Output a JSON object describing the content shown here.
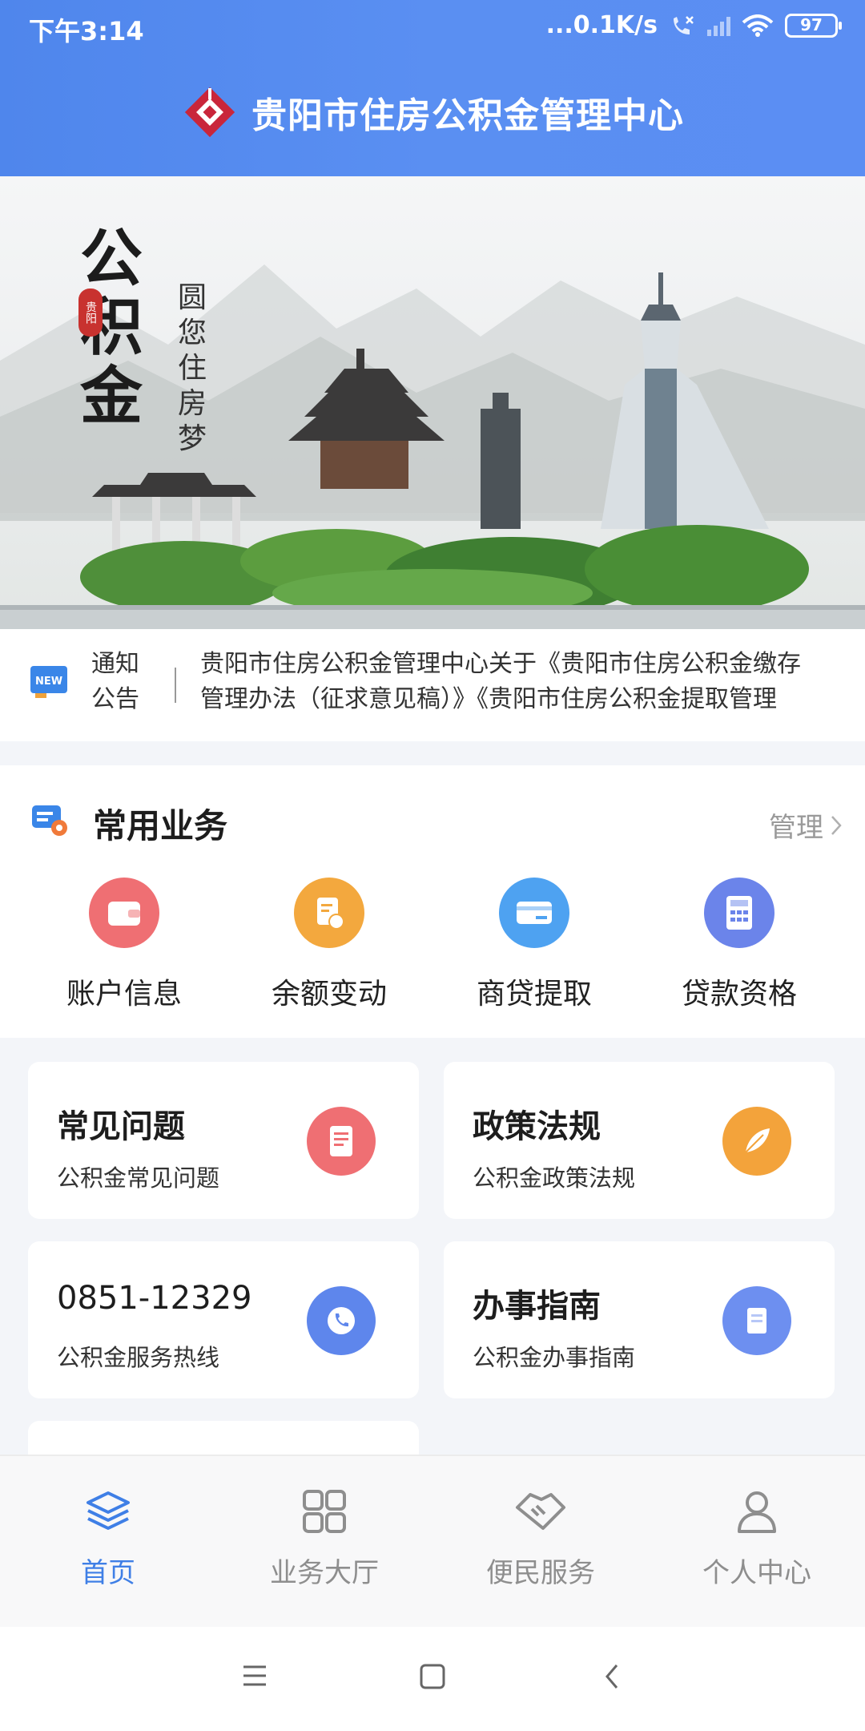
{
  "status_bar": {
    "time": "下午3:14",
    "network_speed": "...0.1K/s",
    "battery": "97"
  },
  "header": {
    "title": "贵阳市住房公积金管理中心",
    "brand_color": "#4f86ec"
  },
  "banner": {
    "slogan_big": "公积金",
    "slogan_small": "圆您住房梦",
    "seal": "贵阳"
  },
  "notice": {
    "label": "通知公告",
    "text_line1": "贵阳市住房公积金管理中心关于《贵阳市住房公积金缴存",
    "text_line2": "管理办法（征求意见稿）》《贵阳市住房公积金提取管理"
  },
  "common_services": {
    "title": "常用业务",
    "manage_label": "管理",
    "items": [
      {
        "label": "账户信息",
        "icon": "wallet-icon",
        "color": "#ef6f73"
      },
      {
        "label": "余额变动",
        "icon": "document-coin-icon",
        "color": "#f3a83e"
      },
      {
        "label": "商贷提取",
        "icon": "card-icon",
        "color": "#4ea2f1"
      },
      {
        "label": "贷款资格",
        "icon": "calculator-icon",
        "color": "#6b84ea"
      }
    ]
  },
  "cards": [
    {
      "title": "常见问题",
      "subtitle": "公积金常见问题",
      "icon": "document-icon",
      "color": "#ef6f73"
    },
    {
      "title": "政策法规",
      "subtitle": "公积金政策法规",
      "icon": "feather-icon",
      "color": "#f3a33b"
    },
    {
      "title": "0851-12329",
      "subtitle": "公积金服务热线",
      "icon": "phone-icon",
      "color": "#5e86ec"
    },
    {
      "title": "办事指南",
      "subtitle": "公积金办事指南",
      "icon": "guide-icon",
      "color": "#6d8ff0"
    }
  ],
  "bottom_nav": {
    "active_color": "#3f7fe6",
    "items": [
      {
        "label": "首页",
        "icon": "layers-icon"
      },
      {
        "label": "业务大厅",
        "icon": "grid-icon"
      },
      {
        "label": "便民服务",
        "icon": "handshake-icon"
      },
      {
        "label": "个人中心",
        "icon": "person-icon"
      }
    ]
  }
}
